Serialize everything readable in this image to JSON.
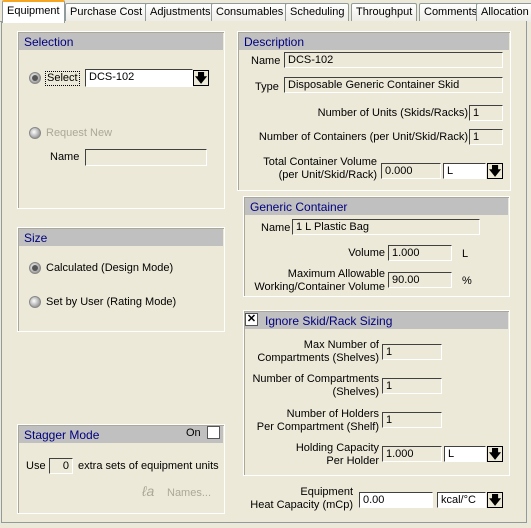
{
  "tabs": [
    "Equipment",
    "Purchase Cost",
    "Adjustments",
    "Consumables",
    "Scheduling",
    "Throughput",
    "Comments",
    "Allocation"
  ],
  "selection": {
    "title": "Selection",
    "select_label": "Select",
    "select_value": "DCS-102",
    "request_new_label": "Request New",
    "name_label": "Name",
    "name_value": ""
  },
  "size": {
    "title": "Size",
    "calculated": "Calculated (Design Mode)",
    "set_by_user": "Set by User (Rating Mode)",
    "selected": "calculated"
  },
  "stagger": {
    "title": "Stagger Mode",
    "on_label": "On",
    "on_checked": false,
    "use_label": "Use",
    "use_value": "0",
    "extra_label": "extra sets of equipment units",
    "names_button": "Names..."
  },
  "description": {
    "title": "Description",
    "name_label": "Name",
    "name_value": "DCS-102",
    "type_label": "Type",
    "type_value": "Disposable Generic Container Skid",
    "units_label": "Number of Units (Skids/Racks)",
    "units_value": "1",
    "containers_label": "Number of Containers (per Unit/Skid/Rack)",
    "containers_value": "1",
    "total_vol_label1": "Total Container Volume",
    "total_vol_label2": "(per Unit/Skid/Rack)",
    "total_vol_value": "0.000",
    "total_vol_unit": "L"
  },
  "generic": {
    "title": "Generic Container",
    "name_label": "Name",
    "name_value": "1 L Plastic Bag",
    "volume_label": "Volume",
    "volume_value": "1.000",
    "volume_unit": "L",
    "max_label1": "Maximum Allowable",
    "max_label2": "Working/Container Volume",
    "max_value": "90.00",
    "max_unit": "%"
  },
  "ignore": {
    "title": "Ignore Skid/Rack Sizing",
    "checked": true,
    "max_comp_label1": "Max Number of",
    "max_comp_label2": "Compartments (Shelves)",
    "max_comp_value": "1",
    "num_comp_label1": "Number of Compartments",
    "num_comp_label2": "(Shelves)",
    "num_comp_value": "1",
    "holders_label1": "Number of Holders",
    "holders_label2": "Per Compartment (Shelf)",
    "holders_value": "1",
    "cap_label1": "Holding Capacity",
    "cap_label2": "Per Holder",
    "cap_value": "1.000",
    "cap_unit": "L"
  },
  "heat": {
    "label1": "Equipment",
    "label2": "Heat Capacity (mCp)",
    "value": "0.00",
    "unit": "kcal/°C"
  }
}
